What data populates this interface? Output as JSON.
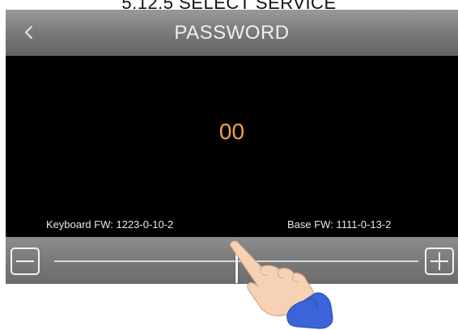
{
  "caption": "5.12.5 SELECT SERVICE",
  "header": {
    "back_icon": "chevron-left-icon",
    "title": "PASSWORD"
  },
  "display": {
    "value": "00"
  },
  "firmware": {
    "keyboard": "Keyboard FW: 1223-0-10-2",
    "base": "Base FW: 1111-0-13-2"
  },
  "slider": {
    "minus_icon": "minus-icon",
    "plus_icon": "plus-icon",
    "level": 0.5
  },
  "hand_icon": "pointing-hand-icon",
  "colors": {
    "value": "#f0a24a",
    "screen_background": "#000000",
    "bar": "#7a7a7a",
    "sleeve": "#3a64d8",
    "skin": "#f6d2b4"
  }
}
